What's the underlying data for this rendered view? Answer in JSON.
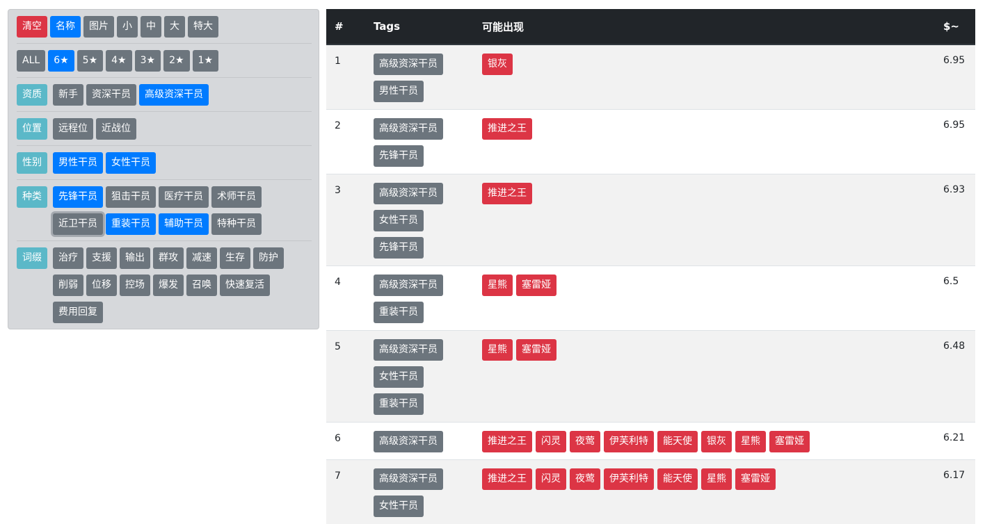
{
  "colors": {
    "primary": "#007bff",
    "secondary": "#6c757d",
    "danger": "#dc3545",
    "info": "#5bb8c8",
    "panel_bg": "#d6d8db",
    "table_head": "#212529"
  },
  "filter": {
    "row1": [
      {
        "label": "清空",
        "style": "danger"
      },
      {
        "label": "名称",
        "style": "primary"
      },
      {
        "label": "图片",
        "style": "secondary"
      },
      {
        "label": "小",
        "style": "secondary"
      },
      {
        "label": "中",
        "style": "secondary"
      },
      {
        "label": "大",
        "style": "secondary"
      },
      {
        "label": "特大",
        "style": "secondary"
      }
    ],
    "stars": [
      {
        "label": "ALL",
        "style": "secondary"
      },
      {
        "label": "6★",
        "style": "primary"
      },
      {
        "label": "5★",
        "style": "secondary"
      },
      {
        "label": "4★",
        "style": "secondary"
      },
      {
        "label": "3★",
        "style": "secondary"
      },
      {
        "label": "2★",
        "style": "secondary"
      },
      {
        "label": "1★",
        "style": "secondary"
      }
    ],
    "groups": [
      {
        "label": "资质",
        "options": [
          {
            "label": "新手",
            "style": "secondary"
          },
          {
            "label": "资深干员",
            "style": "secondary"
          },
          {
            "label": "高级资深干员",
            "style": "primary"
          }
        ]
      },
      {
        "label": "位置",
        "options": [
          {
            "label": "远程位",
            "style": "secondary"
          },
          {
            "label": "近战位",
            "style": "secondary"
          }
        ]
      },
      {
        "label": "性别",
        "options": [
          {
            "label": "男性干员",
            "style": "primary"
          },
          {
            "label": "女性干员",
            "style": "primary"
          }
        ]
      },
      {
        "label": "种类",
        "options": [
          {
            "label": "先锋干员",
            "style": "primary"
          },
          {
            "label": "狙击干员",
            "style": "secondary"
          },
          {
            "label": "医疗干员",
            "style": "secondary"
          },
          {
            "label": "术师干员",
            "style": "secondary"
          },
          {
            "label": "近卫干员",
            "style": "secondary",
            "focus": true
          },
          {
            "label": "重装干员",
            "style": "primary"
          },
          {
            "label": "辅助干员",
            "style": "primary"
          },
          {
            "label": "特种干员",
            "style": "secondary"
          }
        ]
      },
      {
        "label": "词缀",
        "options": [
          {
            "label": "治疗",
            "style": "secondary"
          },
          {
            "label": "支援",
            "style": "secondary"
          },
          {
            "label": "输出",
            "style": "secondary"
          },
          {
            "label": "群攻",
            "style": "secondary"
          },
          {
            "label": "减速",
            "style": "secondary"
          },
          {
            "label": "生存",
            "style": "secondary"
          },
          {
            "label": "防护",
            "style": "secondary"
          },
          {
            "label": "削弱",
            "style": "secondary"
          },
          {
            "label": "位移",
            "style": "secondary"
          },
          {
            "label": "控场",
            "style": "secondary"
          },
          {
            "label": "爆发",
            "style": "secondary"
          },
          {
            "label": "召唤",
            "style": "secondary"
          },
          {
            "label": "快速复活",
            "style": "secondary"
          },
          {
            "label": "费用回复",
            "style": "secondary"
          }
        ]
      }
    ]
  },
  "table": {
    "headers": {
      "num": "#",
      "tags": "Tags",
      "chars": "可能出现",
      "price": "$~"
    },
    "rows": [
      {
        "num": "1",
        "tags": [
          "高级资深干员",
          "男性干员"
        ],
        "chars": [
          "银灰"
        ],
        "price": "6.95"
      },
      {
        "num": "2",
        "tags": [
          "高级资深干员",
          "先锋干员"
        ],
        "chars": [
          "推进之王"
        ],
        "price": "6.95"
      },
      {
        "num": "3",
        "tags": [
          "高级资深干员",
          "女性干员",
          "先锋干员"
        ],
        "chars": [
          "推进之王"
        ],
        "price": "6.93"
      },
      {
        "num": "4",
        "tags": [
          "高级资深干员",
          "重装干员"
        ],
        "chars": [
          "星熊",
          "塞雷娅"
        ],
        "price": "6.5"
      },
      {
        "num": "5",
        "tags": [
          "高级资深干员",
          "女性干员",
          "重装干员"
        ],
        "chars": [
          "星熊",
          "塞雷娅"
        ],
        "price": "6.48"
      },
      {
        "num": "6",
        "tags": [
          "高级资深干员"
        ],
        "chars": [
          "推进之王",
          "闪灵",
          "夜莺",
          "伊芙利特",
          "能天使",
          "银灰",
          "星熊",
          "塞雷娅"
        ],
        "price": "6.21"
      },
      {
        "num": "7",
        "tags": [
          "高级资深干员",
          "女性干员"
        ],
        "chars": [
          "推进之王",
          "闪灵",
          "夜莺",
          "伊芙利特",
          "能天使",
          "星熊",
          "塞雷娅"
        ],
        "price": "6.17"
      }
    ]
  }
}
